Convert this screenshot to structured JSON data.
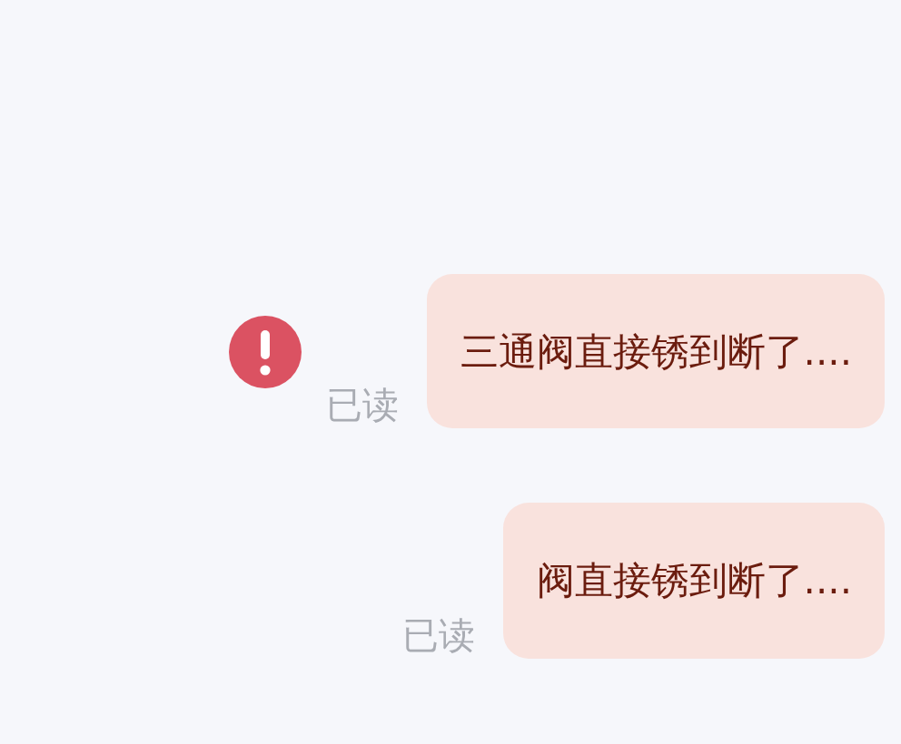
{
  "messages": [
    {
      "text": "三通阀直接锈到断了....",
      "status": "已读",
      "failed": true
    },
    {
      "text": "阀直接锈到断了....",
      "status": "已读",
      "failed": false
    }
  ]
}
